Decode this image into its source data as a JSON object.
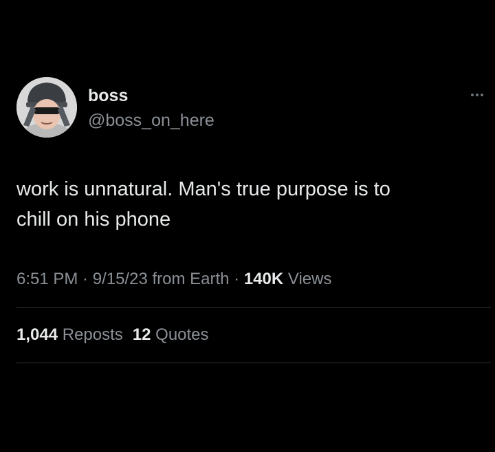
{
  "author": {
    "display_name": "boss",
    "handle": "@boss_on_here",
    "avatar_icon": "avatar-photo"
  },
  "more_icon": "more-options-icon",
  "tweet": {
    "text": "work is unnatural. Man's true purpose is to\nchill on his phone"
  },
  "meta": {
    "time": "6:51 PM",
    "separator": " · ",
    "date_source": "9/15/23 from Earth",
    "views_count": "140K",
    "views_label": " Views"
  },
  "stats": {
    "reposts_count": "1,044",
    "reposts_label": " Reposts",
    "quotes_count": "12",
    "quotes_label": " Quotes"
  },
  "colors": {
    "background": "#000000",
    "primary_text": "#e7e9ea",
    "secondary_text": "#8b9096",
    "divider": "#2f3336"
  }
}
